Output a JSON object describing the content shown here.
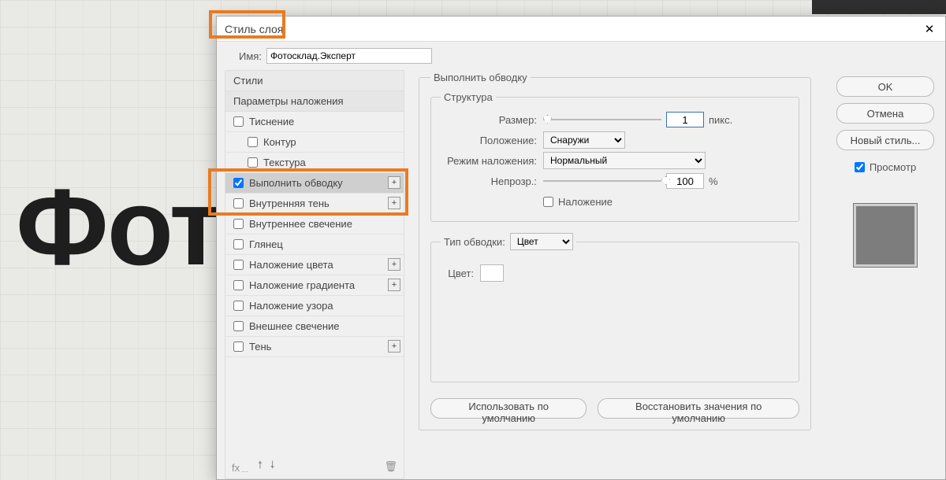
{
  "bg_text": "Фотос",
  "dialog": {
    "title": "Стиль слоя",
    "name_label": "Имя:",
    "name_value": "Фотосклад.Эксперт",
    "styles_header": "Стили",
    "blend_options": "Параметры наложения",
    "rows": [
      {
        "label": "Тиснение",
        "checked": false,
        "plus": false,
        "indent": false
      },
      {
        "label": "Контур",
        "checked": false,
        "plus": false,
        "indent": true
      },
      {
        "label": "Текстура",
        "checked": false,
        "plus": false,
        "indent": true
      },
      {
        "label": "Выполнить обводку",
        "checked": true,
        "plus": true,
        "indent": false,
        "selected": true
      },
      {
        "label": "Внутренняя тень",
        "checked": false,
        "plus": true,
        "indent": false
      },
      {
        "label": "Внутреннее свечение",
        "checked": false,
        "plus": false,
        "indent": false
      },
      {
        "label": "Глянец",
        "checked": false,
        "plus": false,
        "indent": false
      },
      {
        "label": "Наложение цвета",
        "checked": false,
        "plus": true,
        "indent": false
      },
      {
        "label": "Наложение градиента",
        "checked": false,
        "plus": true,
        "indent": false
      },
      {
        "label": "Наложение узора",
        "checked": false,
        "plus": false,
        "indent": false
      },
      {
        "label": "Внешнее свечение",
        "checked": false,
        "plus": false,
        "indent": false
      },
      {
        "label": "Тень",
        "checked": false,
        "plus": true,
        "indent": false
      }
    ]
  },
  "settings": {
    "panel_title": "Выполнить обводку",
    "structure_title": "Структура",
    "size_label": "Размер:",
    "size_value": "1",
    "size_unit": "пикс.",
    "position_label": "Положение:",
    "position_value": "Снаружи",
    "blendmode_label": "Режим наложения:",
    "blendmode_value": "Нормальный",
    "opacity_label": "Непрозр.:",
    "opacity_value": "100",
    "opacity_unit": "%",
    "overprint_label": "Наложение",
    "filltype_label": "Тип обводки:",
    "filltype_value": "Цвет",
    "color_label": "Цвет:",
    "default_btn": "Использовать по умолчанию",
    "reset_btn": "Восстановить значения по умолчанию"
  },
  "actions": {
    "ok": "OK",
    "cancel": "Отмена",
    "new_style": "Новый стиль...",
    "preview": "Просмотр"
  }
}
